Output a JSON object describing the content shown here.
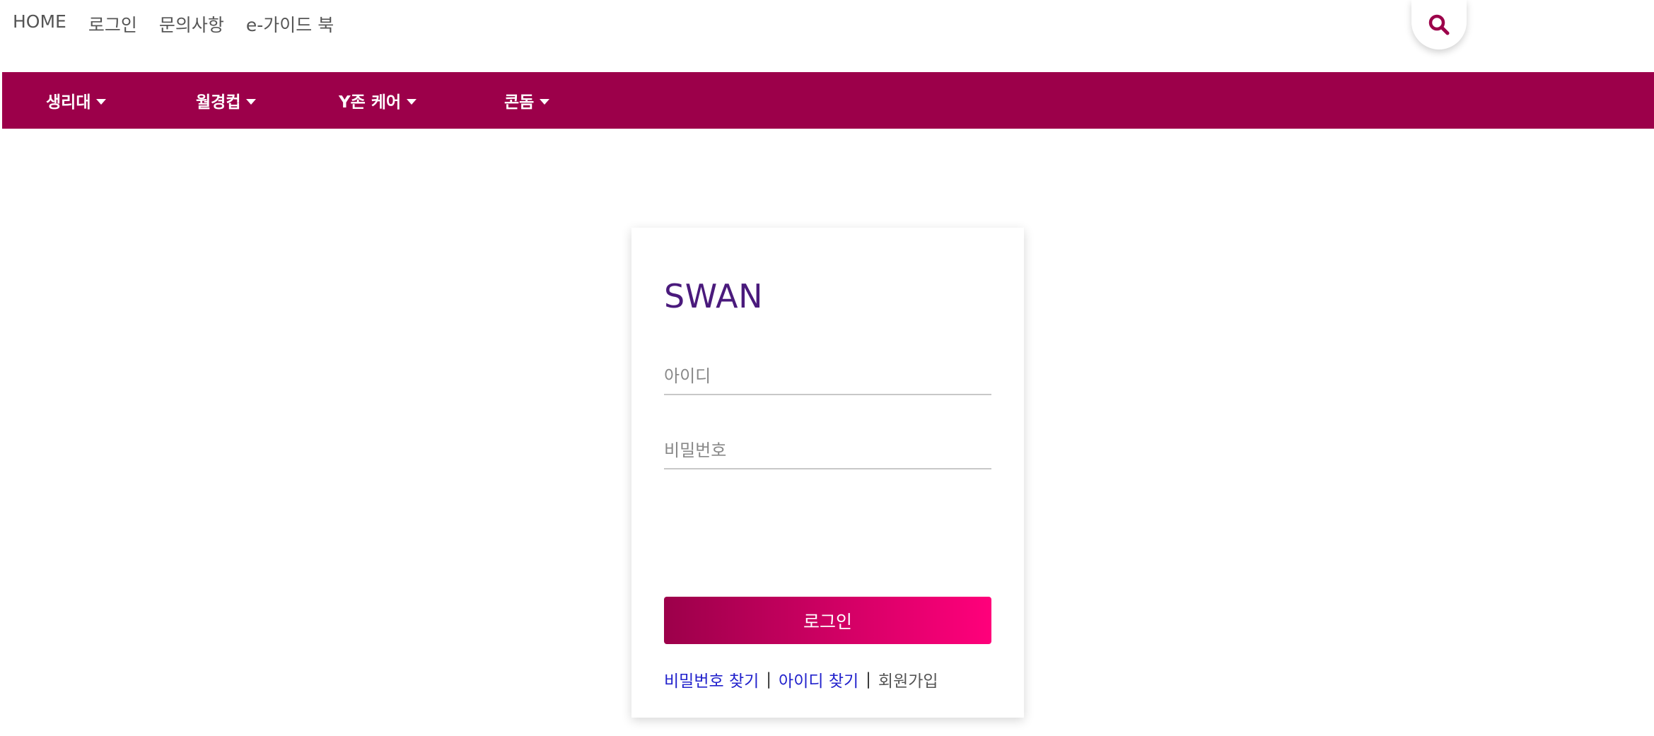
{
  "top_links": [
    {
      "label": "HOME"
    },
    {
      "label": "로그인"
    },
    {
      "label": "문의사항"
    },
    {
      "label": "e-가이드 북"
    }
  ],
  "search": {
    "icon": "search-icon"
  },
  "nav": {
    "items": [
      {
        "label": "생리대"
      },
      {
        "label": "월경컵"
      },
      {
        "label": "Y존 케어"
      },
      {
        "label": "콘돔"
      }
    ]
  },
  "login": {
    "brand": "SWAN",
    "id_placeholder": "아이디",
    "pw_placeholder": "비밀번호",
    "submit_label": "로그인",
    "find_pw": "비밀번호 찾기",
    "find_id": "아이디 찾기",
    "separator": "|",
    "signup": "회원가입"
  },
  "colors": {
    "nav_bg": "#9c004a",
    "brand": "#4a1a7c",
    "button_gradient_start": "#9c004a",
    "button_gradient_end": "#ff007b",
    "link": "#2222cc"
  }
}
